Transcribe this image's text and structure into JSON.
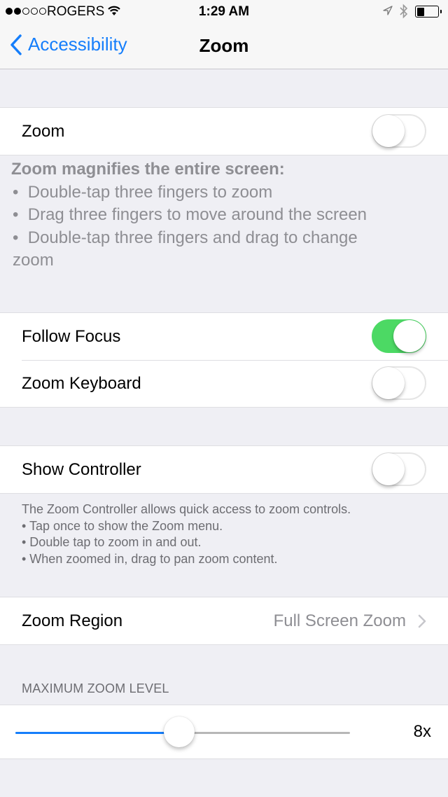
{
  "status_bar": {
    "signal_strength": 2,
    "signal_max": 5,
    "carrier": "ROGERS",
    "time": "1:29 AM",
    "icons": [
      "wifi-icon",
      "location-icon",
      "bluetooth-icon",
      "battery-icon"
    ],
    "battery_level": 0.35
  },
  "nav": {
    "back_label": "Accessibility",
    "title": "Zoom"
  },
  "colors": {
    "accent": "#157efb",
    "toggle_on": "#4cd964",
    "background": "#efeff4"
  },
  "zoom_section": {
    "label": "Zoom",
    "enabled": false,
    "description": {
      "title": "Zoom magnifies the entire screen:",
      "bullets": [
        "Double-tap three fingers to zoom",
        "Drag three fingers to move around the screen",
        "Double-tap three fingers and drag to change zoom"
      ],
      "bullet_char": "•"
    }
  },
  "focus_section": {
    "follow_focus": {
      "label": "Follow Focus",
      "enabled": true
    },
    "zoom_keyboard": {
      "label": "Zoom Keyboard",
      "enabled": false
    }
  },
  "controller_section": {
    "label": "Show Controller",
    "enabled": false,
    "description": [
      "The Zoom Controller allows quick access to zoom controls.",
      "• Tap once to show the Zoom menu.",
      "• Double tap to zoom in and out.",
      "• When zoomed in, drag to pan zoom content."
    ]
  },
  "region_section": {
    "label": "Zoom Region",
    "value": "Full Screen Zoom"
  },
  "max_zoom": {
    "header": "MAXIMUM ZOOM LEVEL",
    "value_label": "8x",
    "slider_fraction": 0.49
  }
}
